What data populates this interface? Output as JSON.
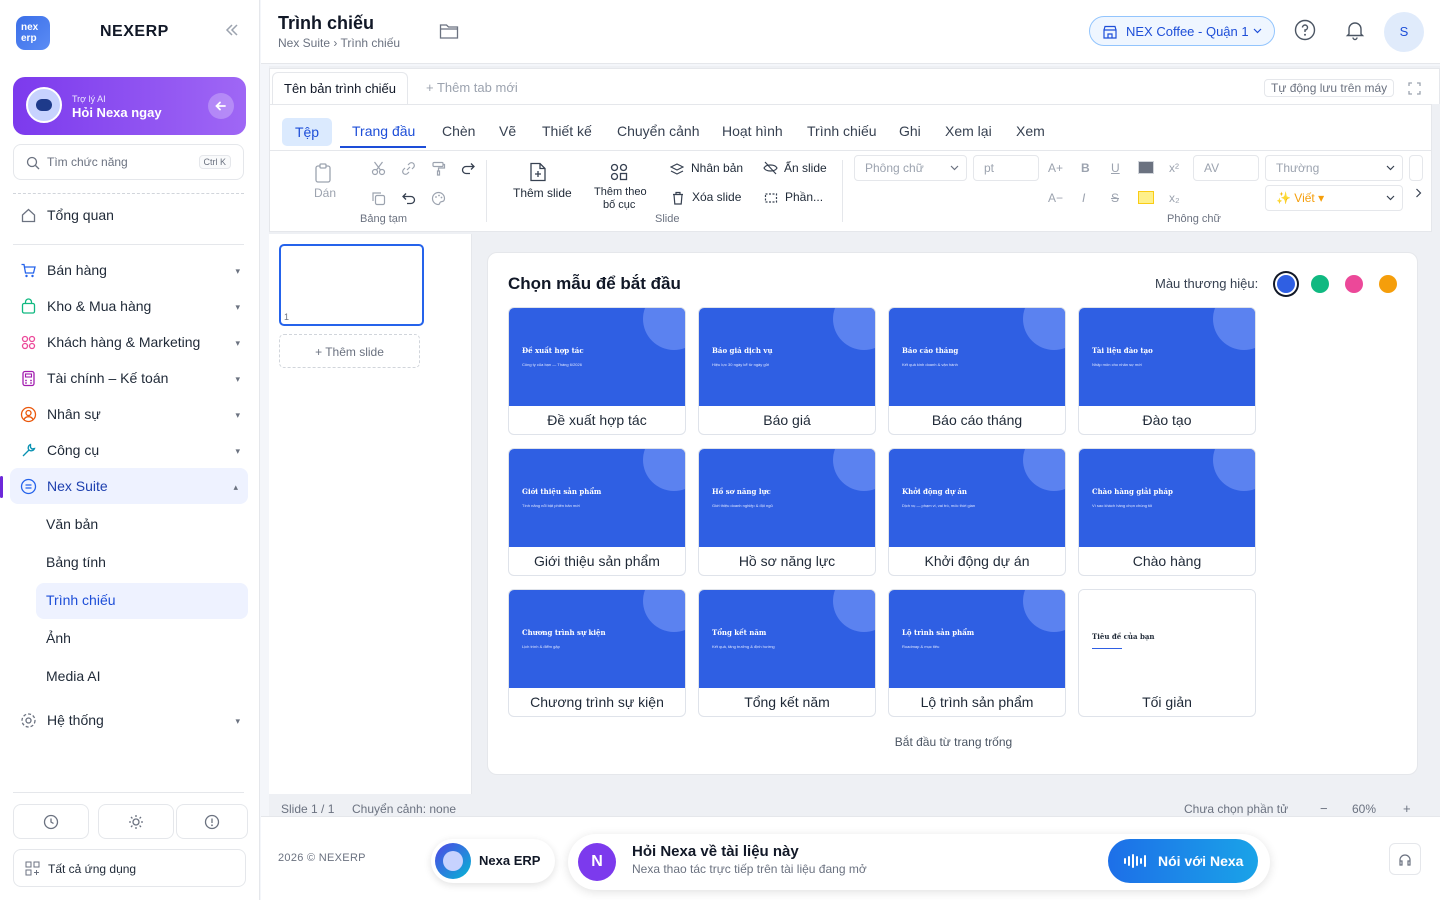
{
  "sidebar": {
    "logo_text": "nex erp",
    "brand": "NEXERP",
    "ai": {
      "small": "Trợ lý AI",
      "big": "Hỏi Nexa ngay"
    },
    "search": {
      "placeholder": "Tìm chức năng",
      "shortcut": "Ctrl K"
    },
    "overview": "Tổng quan",
    "groups": [
      {
        "label": "Bán hàng",
        "icon": "cart-icon"
      },
      {
        "label": "Kho & Mua hàng",
        "icon": "bag-icon"
      },
      {
        "label": "Khách hàng & Marketing",
        "icon": "users-icon"
      },
      {
        "label": "Tài chính – Kế toán",
        "icon": "calculator-icon"
      },
      {
        "label": "Nhân sự",
        "icon": "person-icon"
      },
      {
        "label": "Công cụ",
        "icon": "wrench-icon"
      },
      {
        "label": "Nex Suite",
        "icon": "document-icon"
      }
    ],
    "suite_items": [
      "Văn bản",
      "Bảng tính",
      "Trình chiếu",
      "Ảnh",
      "Media AI"
    ],
    "system": "Hệ thống",
    "all_apps": "Tất cả ứng dụng",
    "caret_down": "▾",
    "caret_up": "▴"
  },
  "header": {
    "title": "Trình chiếu",
    "breadcrumb": "Nex Suite › Trình chiếu",
    "store": "NEX Coffee - Quận 1",
    "avatar": "S"
  },
  "editor": {
    "doc_tab": "Tên bản trình chiếu",
    "new_tab": "+ Thêm tab mới",
    "autosave": "Tự động lưu trên máy",
    "ribbon_tabs": [
      "Tệp",
      "Trang đầu",
      "Chèn",
      "Vẽ",
      "Thiết kế",
      "Chuyển cảnh",
      "Hoạt hình",
      "Trình chiếu",
      "Ghi",
      "Xem lại",
      "Xem"
    ],
    "clipboard": {
      "paste": "Dán",
      "group": "Bảng tạm"
    },
    "slide_group": {
      "add_slide": "Thêm slide",
      "layout_line1": "Thêm theo",
      "layout_line2": "bố cục",
      "duplicate": "Nhân bản",
      "delete": "Xóa slide",
      "hide": "Ẩn slide",
      "section": "Phần...",
      "group": "Slide"
    },
    "font_group": {
      "font": "Phông chữ",
      "size": "pt",
      "grow": "A+",
      "shrink": "A−",
      "bold": "B",
      "italic": "I",
      "underline": "U",
      "strike": "S",
      "superscript": "x²",
      "subscript": "x₂",
      "spacing": "AV",
      "style": "Thường",
      "ai_write": "✨ Viết ▾",
      "group": "Phông chữ"
    },
    "thumb_number": "1",
    "add_slide_panel": "+ Thêm slide",
    "status_left": "Slide 1 / 1",
    "status_transition": "Chuyển cảnh: none",
    "status_selection": "Chưa chọn phần tử",
    "zoom_minus": "−",
    "zoom": "60%",
    "zoom_plus": "+"
  },
  "gallery": {
    "title": "Chọn mẫu để bắt đầu",
    "brand_color_label": "Màu thương hiệu:",
    "brand_colors": [
      "#2f5fe3",
      "#10b981",
      "#ec4899",
      "#f59e0b"
    ],
    "templates": [
      {
        "slide_title": "Đề xuất hợp tác",
        "slide_sub": "Công ty của bạn — Tháng 6/2026",
        "caption": "Đề xuất hợp tác"
      },
      {
        "slide_title": "Báo giá dịch vụ",
        "slide_sub": "Hiệu lực 30 ngày kể từ ngày gửi",
        "caption": "Báo giá"
      },
      {
        "slide_title": "Báo cáo tháng",
        "slide_sub": "Kết quả kinh doanh & vận hành",
        "caption": "Báo cáo tháng"
      },
      {
        "slide_title": "Tài liệu đào tạo",
        "slide_sub": "Nhập môn cho nhân sự mới",
        "caption": "Đào tạo"
      },
      {
        "slide_title": "Giới thiệu sản phẩm",
        "slide_sub": "Tính năng nổi bật phiên bản mới",
        "caption": "Giới thiệu sản phẩm"
      },
      {
        "slide_title": "Hồ sơ năng lực",
        "slide_sub": "Giới thiệu doanh nghiệp & đội ngũ",
        "caption": "Hồ sơ năng lực"
      },
      {
        "slide_title": "Khởi động dự án",
        "slide_sub": "Dịch vụ — phạm vi, vai trò, mốc thời gian",
        "caption": "Khởi động dự án"
      },
      {
        "slide_title": "Chào hàng giải pháp",
        "slide_sub": "Vì sao khách hàng chọn chúng tôi",
        "caption": "Chào hàng"
      },
      {
        "slide_title": "Chương trình sự kiện",
        "slide_sub": "Lịch trình & điểm gặp",
        "caption": "Chương trình sự kiện"
      },
      {
        "slide_title": "Tổng kết năm",
        "slide_sub": "Kết quả, tăng trưởng & định hướng",
        "caption": "Tổng kết năm"
      },
      {
        "slide_title": "Lộ trình sản phẩm",
        "slide_sub": "Roadmap & mục tiêu",
        "caption": "Lộ trình sản phẩm"
      },
      {
        "slide_title": "Tiêu đề của bạn",
        "slide_sub": "",
        "caption": "Tối giản",
        "style": "white"
      }
    ],
    "blank_start": "Bắt đầu từ trang trống"
  },
  "footer": {
    "copyright": "2026 © NEXERP",
    "nexa_pill": "Nexa ERP",
    "ask_badge": "N",
    "ask_title": "Hỏi Nexa về tài liệu này",
    "ask_sub": "Nexa thao tác trực tiếp trên tài liệu đang mở",
    "talk_button": "Nói với Nexa"
  }
}
